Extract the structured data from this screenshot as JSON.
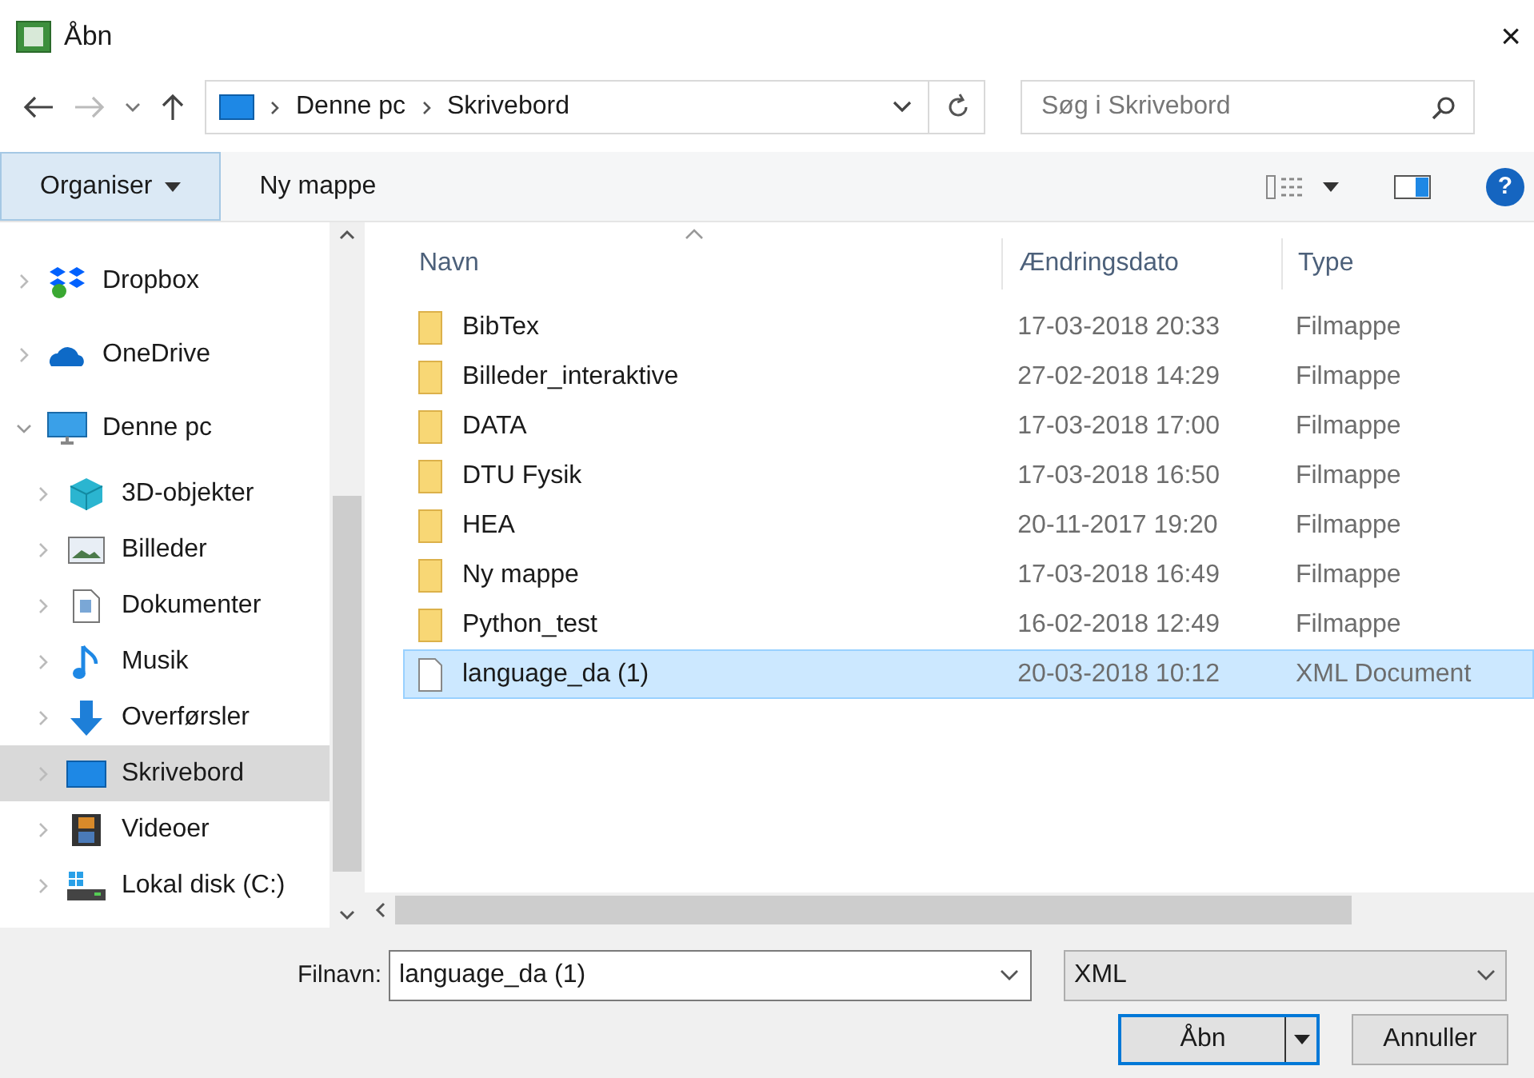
{
  "window": {
    "title": "Åbn",
    "close": "×"
  },
  "address_bar": {
    "crumbs": [
      "Denne pc",
      "Skrivebord"
    ]
  },
  "search": {
    "placeholder": "Søg i Skrivebord"
  },
  "toolbar": {
    "organise": "Organiser",
    "new_folder": "Ny mappe",
    "help": "?"
  },
  "sidebar": {
    "items": [
      {
        "label": "Dropbox",
        "kind": "dropbox",
        "expanded": false,
        "selected": false
      },
      {
        "label": "OneDrive",
        "kind": "cloud",
        "expanded": false,
        "selected": false
      },
      {
        "label": "Denne pc",
        "kind": "pc",
        "expanded": true,
        "selected": false,
        "children": [
          {
            "label": "3D-objekter",
            "kind": "cube",
            "expanded": false,
            "selected": false
          },
          {
            "label": "Billeder",
            "kind": "picture",
            "expanded": false,
            "selected": false
          },
          {
            "label": "Dokumenter",
            "kind": "document",
            "expanded": false,
            "selected": false
          },
          {
            "label": "Musik",
            "kind": "music",
            "expanded": false,
            "selected": false
          },
          {
            "label": "Overførsler",
            "kind": "download",
            "expanded": false,
            "selected": false
          },
          {
            "label": "Skrivebord",
            "kind": "desktop",
            "expanded": false,
            "selected": true
          },
          {
            "label": "Videoer",
            "kind": "video",
            "expanded": false,
            "selected": false
          },
          {
            "label": "Lokal disk (C:)",
            "kind": "disk",
            "expanded": false,
            "selected": false
          }
        ]
      }
    ]
  },
  "table": {
    "columns": [
      "Navn",
      "Ændringsdato",
      "Type"
    ],
    "rows": [
      {
        "name": "BibTex",
        "date": "17-03-2018 20:33",
        "type": "Filmappe",
        "kind": "folder",
        "selected": false
      },
      {
        "name": "Billeder_interaktive",
        "date": "27-02-2018 14:29",
        "type": "Filmappe",
        "kind": "folder",
        "selected": false
      },
      {
        "name": "DATA",
        "date": "17-03-2018 17:00",
        "type": "Filmappe",
        "kind": "folder",
        "selected": false
      },
      {
        "name": "DTU Fysik",
        "date": "17-03-2018 16:50",
        "type": "Filmappe",
        "kind": "folder",
        "selected": false
      },
      {
        "name": "HEA",
        "date": "20-11-2017 19:20",
        "type": "Filmappe",
        "kind": "folder",
        "selected": false
      },
      {
        "name": "Ny mappe",
        "date": "17-03-2018 16:49",
        "type": "Filmappe",
        "kind": "folder",
        "selected": false
      },
      {
        "name": "Python_test",
        "date": "16-02-2018 12:49",
        "type": "Filmappe",
        "kind": "folder",
        "selected": false
      },
      {
        "name": "language_da (1)",
        "date": "20-03-2018 10:12",
        "type": "XML Document",
        "kind": "file",
        "selected": true
      }
    ]
  },
  "footer": {
    "filename_label": "Filnavn:",
    "filename": "language_da (1)",
    "filter": "XML",
    "open": "Åbn",
    "cancel": "Annuller"
  }
}
